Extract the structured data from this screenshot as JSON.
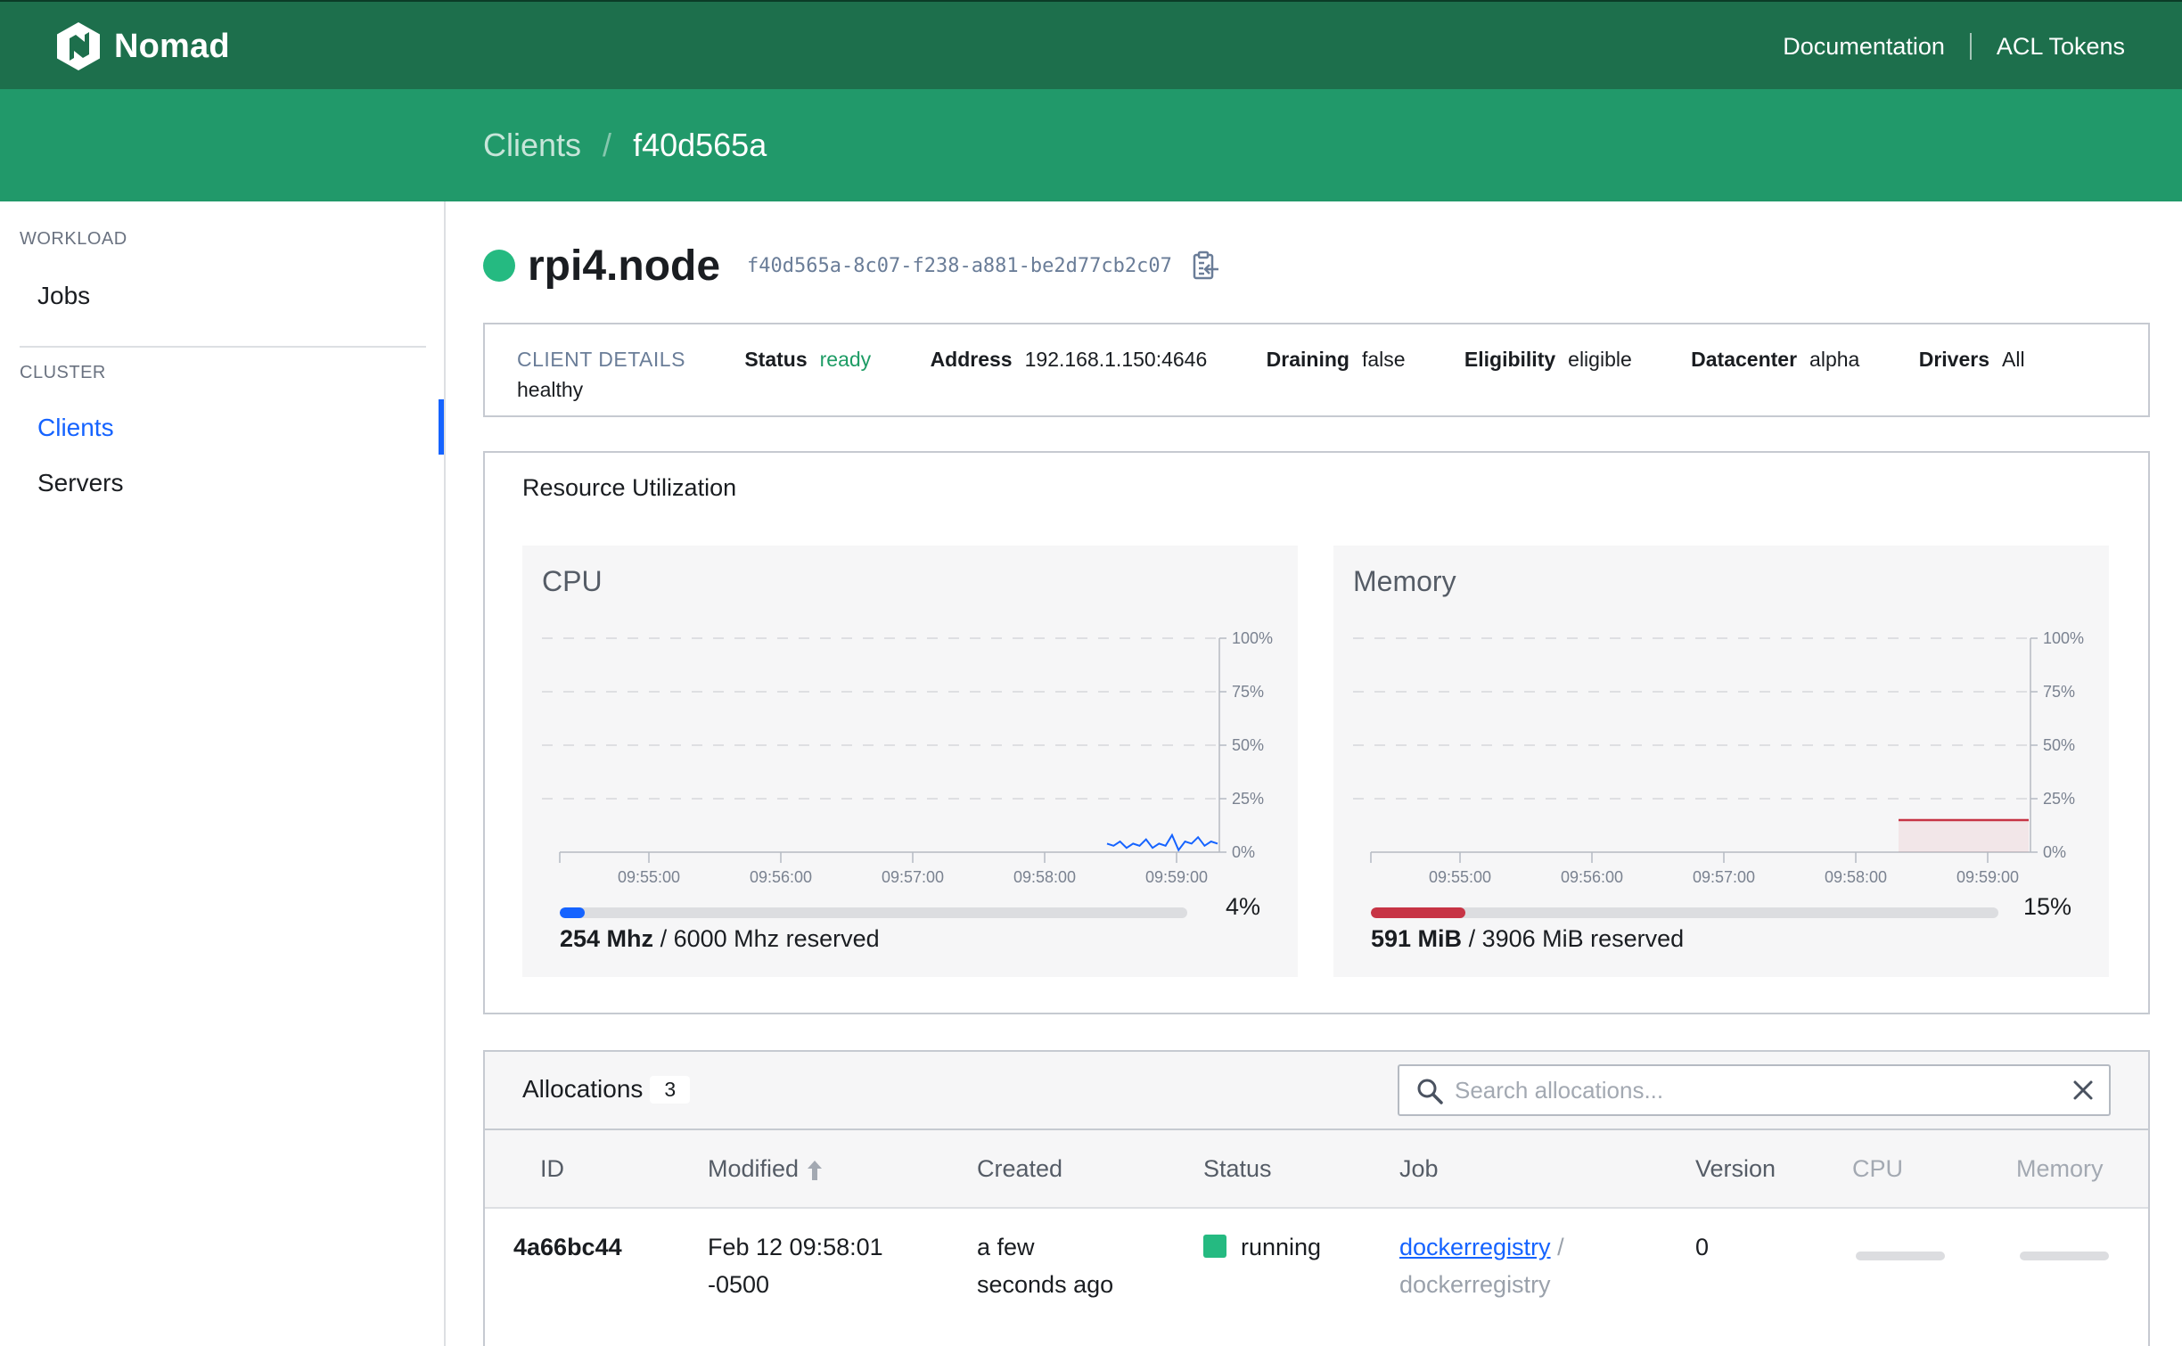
{
  "app": {
    "name": "Nomad"
  },
  "topnav": {
    "documentation": "Documentation",
    "acl_tokens": "ACL Tokens"
  },
  "breadcrumb": {
    "parent": "Clients",
    "separator": "/",
    "current": "f40d565a"
  },
  "sidebar": {
    "workload_heading": "WORKLOAD",
    "jobs": "Jobs",
    "cluster_heading": "CLUSTER",
    "clients": "Clients",
    "servers": "Servers",
    "active_item": "Clients"
  },
  "node": {
    "name": "rpi4.node",
    "id": "f40d565a-8c07-f238-a881-be2d77cb2c07",
    "status_color": "#25ba81"
  },
  "client_details": {
    "label": "CLIENT DETAILS",
    "status_key": "Status",
    "status_val": "ready",
    "address_key": "Address",
    "address_val": "192.168.1.150:4646",
    "draining_key": "Draining",
    "draining_val": "false",
    "eligibility_key": "Eligibility",
    "eligibility_val": "eligible",
    "datacenter_key": "Datacenter",
    "datacenter_val": "alpha",
    "drivers_key": "Drivers",
    "drivers_val": "All",
    "drivers_val_wrap": "healthy"
  },
  "resources": {
    "title": "Resource Utilization",
    "cpu": {
      "title": "CPU",
      "used": "254 Mhz",
      "reserved_text": "/ 6000 Mhz reserved",
      "percent_label": "4%",
      "fraction": 0.04,
      "color": "#1563ff"
    },
    "memory": {
      "title": "Memory",
      "used": "591 MiB",
      "reserved_text": "/ 3906 MiB reserved",
      "percent_label": "15%",
      "fraction": 0.15,
      "color": "#c73445"
    }
  },
  "chart_data": [
    {
      "type": "line",
      "title": "CPU",
      "x_ticks": [
        "09:55:00",
        "09:56:00",
        "09:57:00",
        "09:58:00",
        "09:59:00"
      ],
      "y_ticks": [
        "0%",
        "25%",
        "50%",
        "75%",
        "100%"
      ],
      "ylim": [
        0,
        100
      ],
      "grid": true,
      "series": [
        {
          "values": [
            4,
            3,
            5,
            2,
            4,
            3,
            6,
            2,
            4,
            3,
            8,
            1,
            5,
            4,
            7,
            3,
            5,
            4
          ]
        }
      ],
      "series_color": "#1563ff"
    },
    {
      "type": "area",
      "title": "Memory",
      "x_ticks": [
        "09:55:00",
        "09:56:00",
        "09:57:00",
        "09:58:00",
        "09:59:00"
      ],
      "y_ticks": [
        "0%",
        "25%",
        "50%",
        "75%",
        "100%"
      ],
      "ylim": [
        0,
        100
      ],
      "grid": true,
      "series": [
        {
          "values": [
            15,
            15,
            15,
            15,
            15,
            15
          ]
        }
      ],
      "series_color": "#c73445"
    }
  ],
  "allocations": {
    "title": "Allocations",
    "count": "3",
    "search_placeholder": "Search allocations...",
    "columns": [
      "ID",
      "Modified",
      "Created",
      "Status",
      "Job",
      "Version",
      "CPU",
      "Memory"
    ],
    "rows": [
      {
        "id": "4a66bc44",
        "modified_line1": "Feb 12 09:58:01",
        "modified_line2": "-0500",
        "created_line1": "a few",
        "created_line2": "seconds ago",
        "status": "running",
        "job": "dockerregistry",
        "job_sep": "/",
        "task_group": "dockerregistry",
        "version": "0"
      }
    ]
  }
}
